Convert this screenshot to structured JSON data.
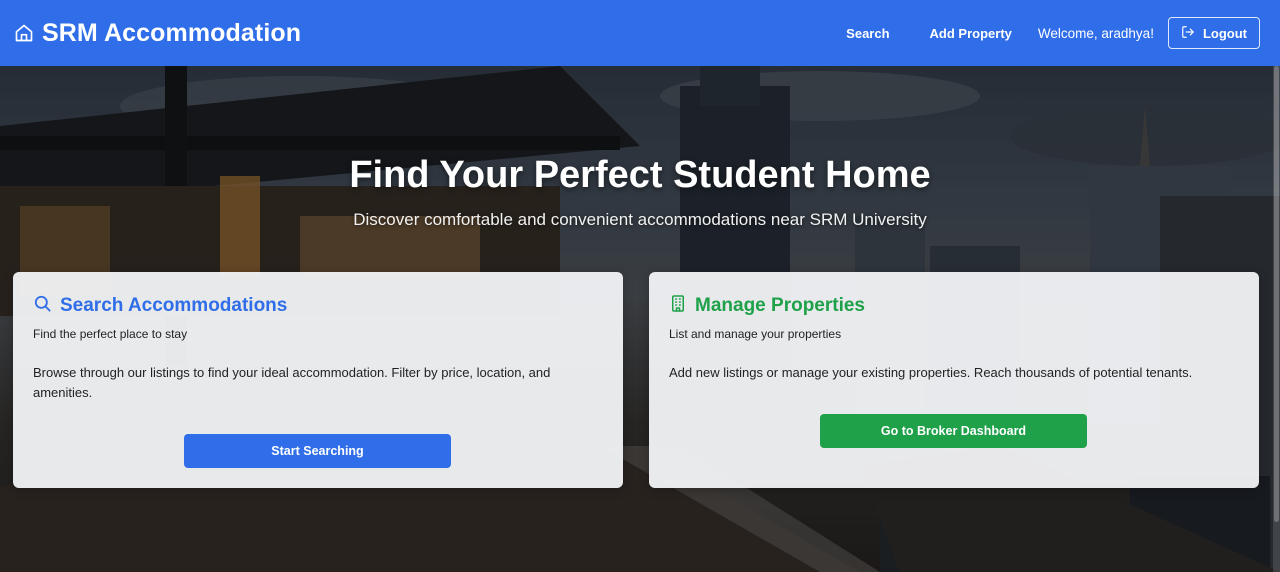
{
  "nav": {
    "brand": "SRM Accommodation",
    "links": {
      "search": "Search",
      "add_property": "Add Property"
    },
    "welcome": "Welcome, aradhya!",
    "logout": "Logout"
  },
  "hero": {
    "title": "Find Your Perfect Student Home",
    "subtitle": "Discover comfortable and convenient accommodations near SRM University"
  },
  "cards": {
    "search": {
      "title": "Search Accommodations",
      "subtitle": "Find the perfect place to stay",
      "description": "Browse through our listings to find your ideal accommodation. Filter by price, location, and amenities.",
      "button": "Start Searching",
      "icon": "search-icon"
    },
    "manage": {
      "title": "Manage Properties",
      "subtitle": "List and manage your properties",
      "description": "Add new listings or manage your existing properties. Reach thousands of potential tenants.",
      "button": "Go to Broker Dashboard",
      "icon": "building-icon"
    }
  },
  "colors": {
    "primary": "#2f6ee8",
    "success": "#1fa14a"
  }
}
